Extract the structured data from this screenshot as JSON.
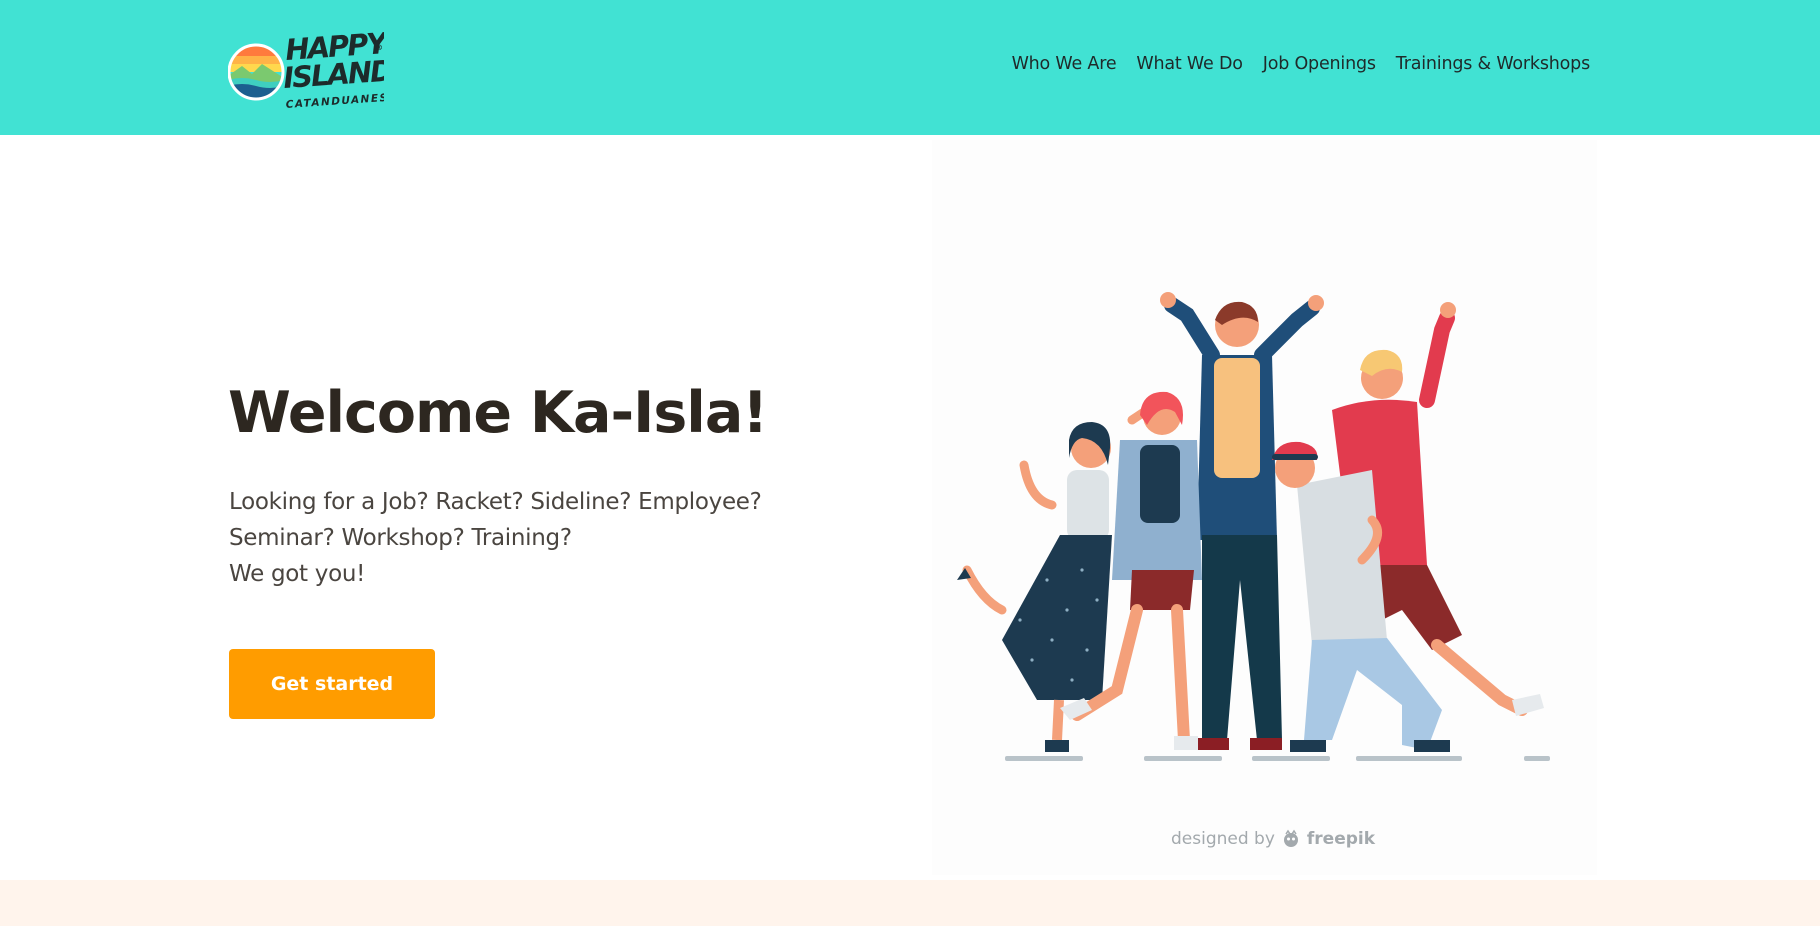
{
  "brand": {
    "name": "HAPPY ISLAND",
    "line1": "HAPPY",
    "line2": "ISLAND",
    "tagline": "CATANDUANES",
    "registered": "®",
    "logo_colors": [
      "#ff7a3d",
      "#ffd84d",
      "#3fcfc0",
      "#1c5f8f"
    ]
  },
  "nav": {
    "items": [
      {
        "label": "Who We Are"
      },
      {
        "label": "What We Do"
      },
      {
        "label": "Job Openings"
      },
      {
        "label": "Trainings & Workshops"
      }
    ]
  },
  "hero": {
    "title": "Welcome Ka-Isla!",
    "lines": [
      "Looking for a Job? Racket? Sideline? Employee?",
      "Seminar? Workshop? Training?",
      "We got you!"
    ],
    "cta_label": "Get started"
  },
  "illustration": {
    "credit_prefix": "designed by",
    "credit_brand": "freepik"
  },
  "colors": {
    "header_bg": "#41e2d3",
    "cta_bg": "#ff9c00",
    "footer_strip": "#fff4ec"
  }
}
